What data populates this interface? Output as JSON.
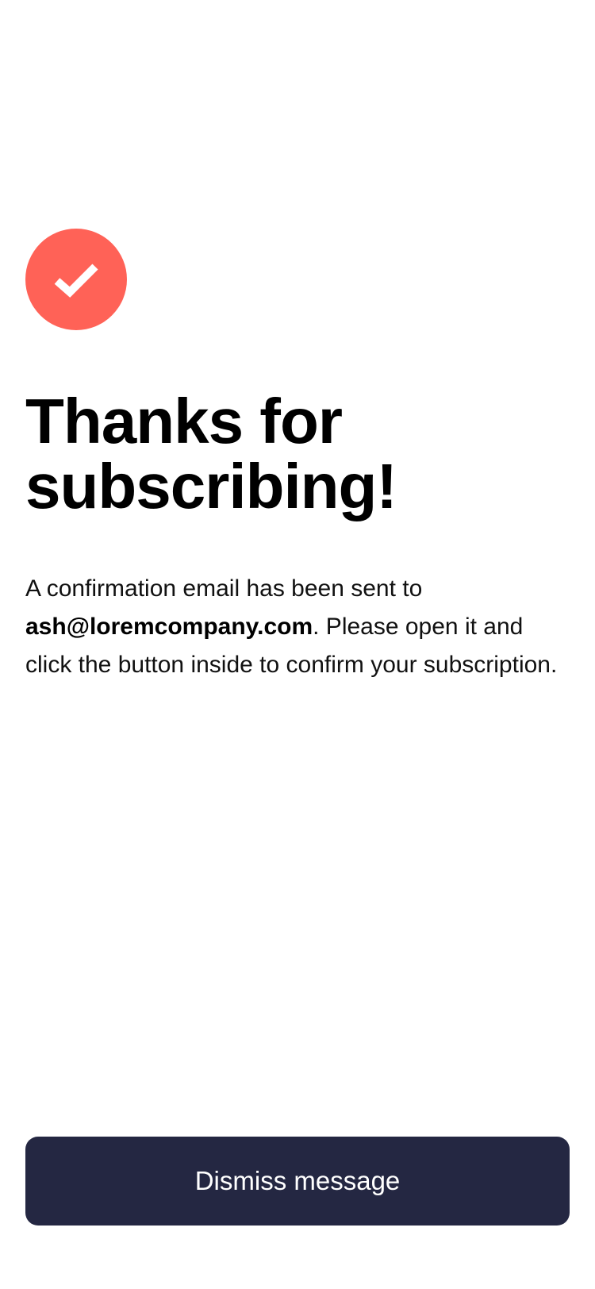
{
  "success_icon": {
    "icon": "checkmark-icon",
    "background_color": "#ff6257"
  },
  "heading": {
    "title": "Thanks for subscribing!"
  },
  "message": {
    "intro": "A confirmation email has been sent to ",
    "email": "ash@loremcompany.com",
    "outro": ". Please open it and click the button inside to confirm your subscription."
  },
  "actions": {
    "dismiss_label": "Dismiss message",
    "button_color": "#242742"
  }
}
